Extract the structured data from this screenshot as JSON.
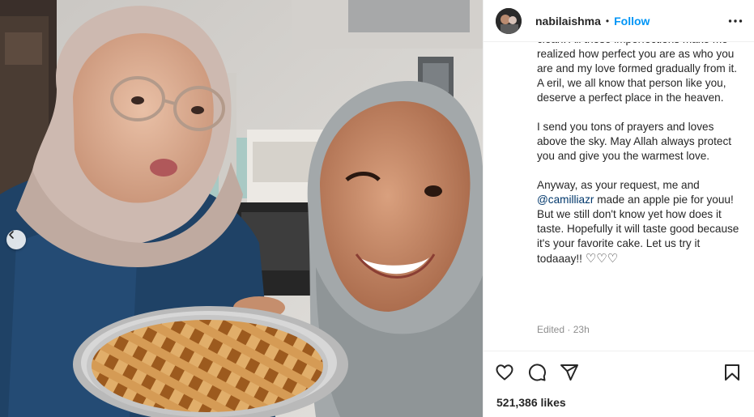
{
  "post": {
    "username": "nabilaishma",
    "separator": "•",
    "follow_label": "Follow",
    "caption_paragraphs": [
      {
        "text": "clean. All those imperfections make me realized how perfect you are as who you are and my love formed gradually from it. A eril, we all know that person like you, deserve a perfect place in the heaven."
      },
      {
        "text": "I send you tons of prayers and loves above the sky. May Allah always protect you and give you the warmest love."
      }
    ],
    "caption_last": {
      "before": "Anyway, as your request, me and ",
      "mention": "@camilliazr",
      "after": " made an apple pie for youu! But we still don't know yet how does it taste. Hopefully it will taste good because it's your favorite cake. Let us try it todaaay!! ",
      "emoji": "♡♡♡"
    },
    "edited_label": "Edited",
    "time_separator": "·",
    "time_ago": "23h",
    "likes_count": "521,386",
    "likes_suffix": "likes"
  },
  "icons": {
    "more": "more-horizontal-icon",
    "like": "heart-icon",
    "comment": "comment-bubble-icon",
    "share": "paper-plane-icon",
    "save": "bookmark-icon",
    "carousel_prev": "chevron-left-icon"
  },
  "colors": {
    "link_blue": "#0095f6",
    "mention": "#00376b",
    "secondary_text": "#8e8e8e",
    "border": "#efefef"
  }
}
